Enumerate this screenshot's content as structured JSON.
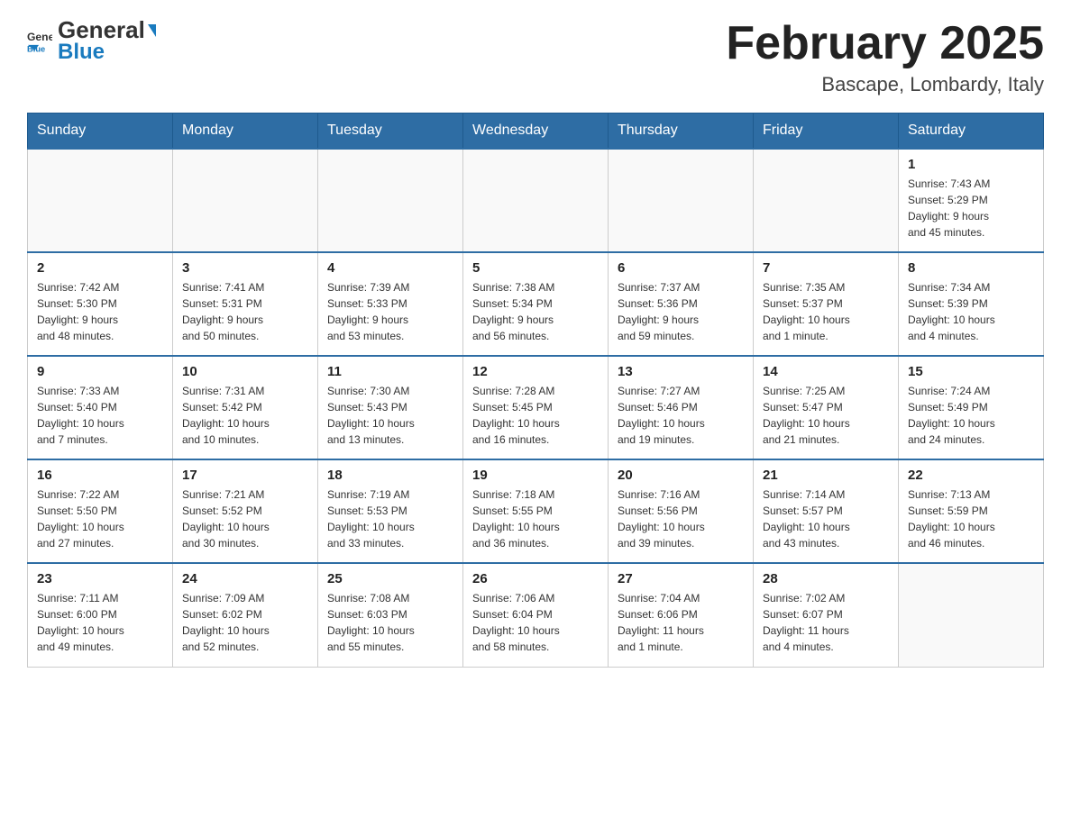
{
  "header": {
    "logo_text_general": "General",
    "logo_text_blue": "Blue",
    "month_title": "February 2025",
    "subtitle": "Bascape, Lombardy, Italy"
  },
  "weekdays": [
    "Sunday",
    "Monday",
    "Tuesday",
    "Wednesday",
    "Thursday",
    "Friday",
    "Saturday"
  ],
  "weeks": [
    [
      {
        "day": "",
        "info": ""
      },
      {
        "day": "",
        "info": ""
      },
      {
        "day": "",
        "info": ""
      },
      {
        "day": "",
        "info": ""
      },
      {
        "day": "",
        "info": ""
      },
      {
        "day": "",
        "info": ""
      },
      {
        "day": "1",
        "info": "Sunrise: 7:43 AM\nSunset: 5:29 PM\nDaylight: 9 hours\nand 45 minutes."
      }
    ],
    [
      {
        "day": "2",
        "info": "Sunrise: 7:42 AM\nSunset: 5:30 PM\nDaylight: 9 hours\nand 48 minutes."
      },
      {
        "day": "3",
        "info": "Sunrise: 7:41 AM\nSunset: 5:31 PM\nDaylight: 9 hours\nand 50 minutes."
      },
      {
        "day": "4",
        "info": "Sunrise: 7:39 AM\nSunset: 5:33 PM\nDaylight: 9 hours\nand 53 minutes."
      },
      {
        "day": "5",
        "info": "Sunrise: 7:38 AM\nSunset: 5:34 PM\nDaylight: 9 hours\nand 56 minutes."
      },
      {
        "day": "6",
        "info": "Sunrise: 7:37 AM\nSunset: 5:36 PM\nDaylight: 9 hours\nand 59 minutes."
      },
      {
        "day": "7",
        "info": "Sunrise: 7:35 AM\nSunset: 5:37 PM\nDaylight: 10 hours\nand 1 minute."
      },
      {
        "day": "8",
        "info": "Sunrise: 7:34 AM\nSunset: 5:39 PM\nDaylight: 10 hours\nand 4 minutes."
      }
    ],
    [
      {
        "day": "9",
        "info": "Sunrise: 7:33 AM\nSunset: 5:40 PM\nDaylight: 10 hours\nand 7 minutes."
      },
      {
        "day": "10",
        "info": "Sunrise: 7:31 AM\nSunset: 5:42 PM\nDaylight: 10 hours\nand 10 minutes."
      },
      {
        "day": "11",
        "info": "Sunrise: 7:30 AM\nSunset: 5:43 PM\nDaylight: 10 hours\nand 13 minutes."
      },
      {
        "day": "12",
        "info": "Sunrise: 7:28 AM\nSunset: 5:45 PM\nDaylight: 10 hours\nand 16 minutes."
      },
      {
        "day": "13",
        "info": "Sunrise: 7:27 AM\nSunset: 5:46 PM\nDaylight: 10 hours\nand 19 minutes."
      },
      {
        "day": "14",
        "info": "Sunrise: 7:25 AM\nSunset: 5:47 PM\nDaylight: 10 hours\nand 21 minutes."
      },
      {
        "day": "15",
        "info": "Sunrise: 7:24 AM\nSunset: 5:49 PM\nDaylight: 10 hours\nand 24 minutes."
      }
    ],
    [
      {
        "day": "16",
        "info": "Sunrise: 7:22 AM\nSunset: 5:50 PM\nDaylight: 10 hours\nand 27 minutes."
      },
      {
        "day": "17",
        "info": "Sunrise: 7:21 AM\nSunset: 5:52 PM\nDaylight: 10 hours\nand 30 minutes."
      },
      {
        "day": "18",
        "info": "Sunrise: 7:19 AM\nSunset: 5:53 PM\nDaylight: 10 hours\nand 33 minutes."
      },
      {
        "day": "19",
        "info": "Sunrise: 7:18 AM\nSunset: 5:55 PM\nDaylight: 10 hours\nand 36 minutes."
      },
      {
        "day": "20",
        "info": "Sunrise: 7:16 AM\nSunset: 5:56 PM\nDaylight: 10 hours\nand 39 minutes."
      },
      {
        "day": "21",
        "info": "Sunrise: 7:14 AM\nSunset: 5:57 PM\nDaylight: 10 hours\nand 43 minutes."
      },
      {
        "day": "22",
        "info": "Sunrise: 7:13 AM\nSunset: 5:59 PM\nDaylight: 10 hours\nand 46 minutes."
      }
    ],
    [
      {
        "day": "23",
        "info": "Sunrise: 7:11 AM\nSunset: 6:00 PM\nDaylight: 10 hours\nand 49 minutes."
      },
      {
        "day": "24",
        "info": "Sunrise: 7:09 AM\nSunset: 6:02 PM\nDaylight: 10 hours\nand 52 minutes."
      },
      {
        "day": "25",
        "info": "Sunrise: 7:08 AM\nSunset: 6:03 PM\nDaylight: 10 hours\nand 55 minutes."
      },
      {
        "day": "26",
        "info": "Sunrise: 7:06 AM\nSunset: 6:04 PM\nDaylight: 10 hours\nand 58 minutes."
      },
      {
        "day": "27",
        "info": "Sunrise: 7:04 AM\nSunset: 6:06 PM\nDaylight: 11 hours\nand 1 minute."
      },
      {
        "day": "28",
        "info": "Sunrise: 7:02 AM\nSunset: 6:07 PM\nDaylight: 11 hours\nand 4 minutes."
      },
      {
        "day": "",
        "info": ""
      }
    ]
  ]
}
